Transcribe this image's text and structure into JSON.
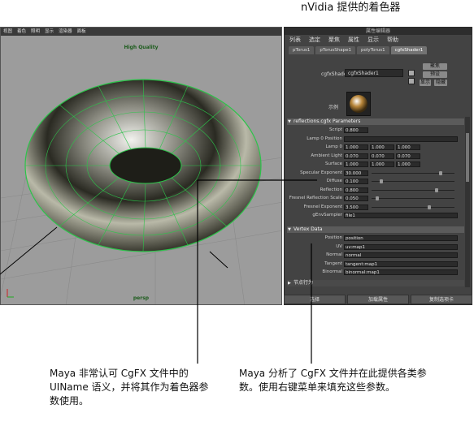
{
  "title": "nVidia 提供的着色器",
  "viewport": {
    "menu": [
      "视图",
      "着色",
      "照明",
      "显示",
      "渲染器",
      "面板"
    ],
    "quality_label": "High Quality",
    "camera_label": "persp"
  },
  "attribute_editor": {
    "window_title": "属性编辑器",
    "menu": [
      "列表",
      "选定",
      "聚焦",
      "属性",
      "显示",
      "帮助"
    ],
    "tabs": [
      "pTorus1",
      "pTorusShape1",
      "polyTorus1",
      "cgfxShader1"
    ],
    "active_tab": "cgfxShader1",
    "shader_label": "cgfxShader:",
    "shader_value": "cgfxShader1",
    "focus_label": "聚焦",
    "presets_label": "预设",
    "show_label": "显示",
    "hide_label": "隐藏",
    "sample_label": "示例",
    "sections": {
      "reflections": "reflections.cgfx Parameters",
      "vertex": "Vertex Data",
      "node_behavior": "节点行为"
    },
    "params": [
      {
        "label": "Script",
        "values": [
          "0.800"
        ]
      },
      {
        "label": "Lamp 0 Position",
        "values": [
          ""
        ]
      },
      {
        "label": "Lamp 0",
        "values": [
          "1.000",
          "1.000",
          "1.000"
        ]
      },
      {
        "label": "Ambient Light",
        "values": [
          "0.070",
          "0.070",
          "0.070"
        ]
      },
      {
        "label": "Surface",
        "values": [
          "1.000",
          "1.000",
          "1.000"
        ]
      },
      {
        "label": "Specular Exponent",
        "values": [
          "30.000"
        ],
        "slider": 0.85
      },
      {
        "label": "Diffuse",
        "values": [
          "0.100"
        ],
        "slider": 0.1
      },
      {
        "label": "Reflection",
        "values": [
          "0.800"
        ],
        "slider": 0.8
      },
      {
        "label": "Fresnel Reflection Scale",
        "values": [
          "0.050"
        ],
        "slider": 0.05
      },
      {
        "label": "Fresnel Exponent",
        "values": [
          "3.500"
        ],
        "slider": 0.7
      },
      {
        "label": "gEnvSampler",
        "values": [
          "file1"
        ]
      }
    ],
    "vertex_data": [
      {
        "label": "Position",
        "value": "position"
      },
      {
        "label": "UV",
        "value": "uv:map1"
      },
      {
        "label": "Normal",
        "value": "normal"
      },
      {
        "label": "Tangent",
        "value": "tangent:map1"
      },
      {
        "label": "Binormal",
        "value": "binormal:map1"
      }
    ],
    "bottom_buttons": [
      "选择",
      "加载属性",
      "复制选项卡"
    ]
  },
  "notes": {
    "left": "Maya 非常认可 CgFX 文件中的 UIName 语义，并将其作为着色器参数使用。",
    "right": "Maya 分析了 CgFX 文件并在此提供各类参数。使用右键菜单来填充这些参数。"
  }
}
